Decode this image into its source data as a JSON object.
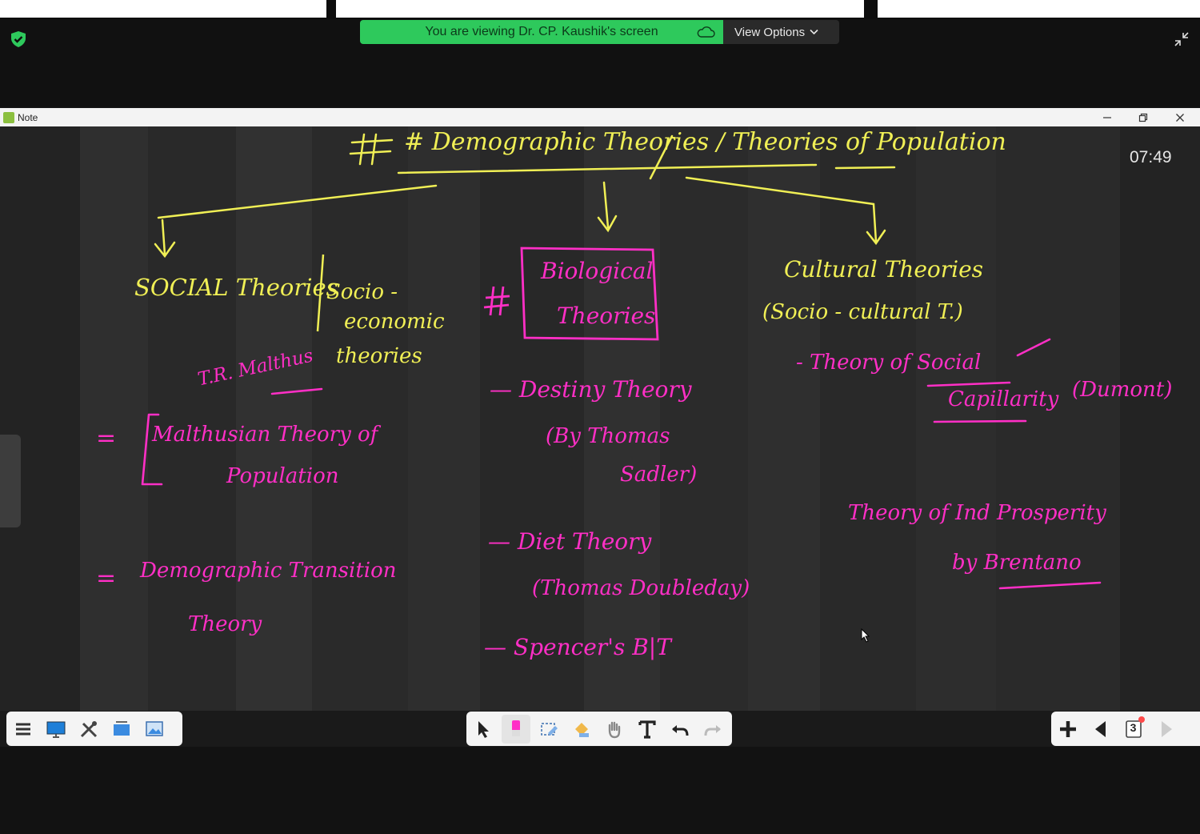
{
  "meeting": {
    "share_banner": "You are viewing Dr. CP. Kaushik's screen",
    "view_options_label": "View Options"
  },
  "note_window": {
    "title": "Note",
    "timer": "07:49"
  },
  "board": {
    "heading": "# Demographic Theories / Theories of Population",
    "social": {
      "title_line1": "SOCIAL Theories",
      "title_side1": "Socio -",
      "title_side2": "economic",
      "title_side3": "theories",
      "author": "T.R. Malthus",
      "item1_prefix": "=",
      "item1_line1": "Malthusian Theory of",
      "item1_line2": "Population",
      "item2_prefix": "=",
      "item2_line1": "Demographic Transition",
      "item2_line2": "Theory"
    },
    "biological": {
      "hash": "#",
      "title_line1": "Biological",
      "title_line2": "Theories",
      "item1": "— Destiny Theory",
      "item1_sub1": "(By Thomas",
      "item1_sub2": "Sadler)",
      "item2": "— Diet Theory",
      "item2_sub": "(Thomas Doubleday)",
      "item3": "— Spencer's B|T"
    },
    "cultural": {
      "title_line1": "Cultural Theories",
      "title_line2": "(Socio - cultural T.)",
      "item1_line1": "- Theory of Social",
      "item1_line2": "Capillarity",
      "item1_note": "(Dumont)",
      "item2_line1": "Theory of Ind Prosperity",
      "item2_line2": "by Brentano"
    }
  },
  "toolbar": {
    "left_tools": [
      "menu-icon",
      "desktop-icon",
      "tools-icon",
      "screen-capture-icon",
      "image-icon"
    ],
    "center_tools": [
      "select-arrow-icon",
      "pen-icon",
      "eraser-icon",
      "fill-icon",
      "hand-icon",
      "text-tool-icon",
      "undo-icon",
      "redo-icon"
    ],
    "right_tools": [
      "add-page-icon",
      "prev-page-icon",
      "page-counter-icon",
      "next-page-icon"
    ],
    "page_number": "3"
  },
  "colors": {
    "banner_green": "#2ec95c",
    "chalk_yellow": "#f0ef55",
    "chalk_magenta": "#ff2fc6"
  }
}
